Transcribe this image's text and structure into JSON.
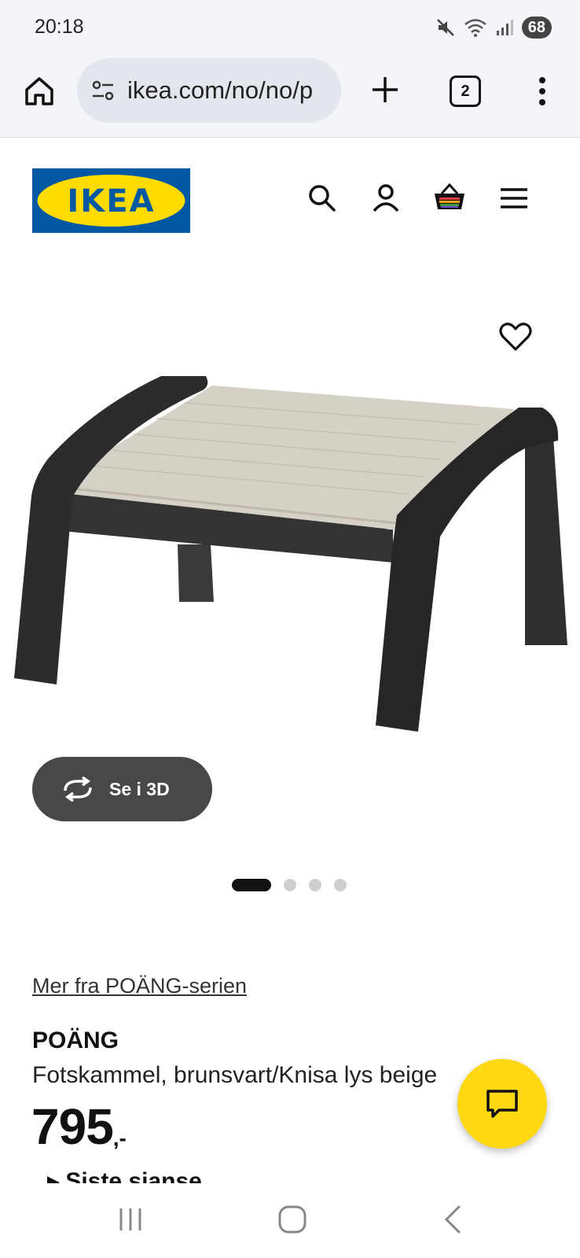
{
  "status": {
    "time": "20:18",
    "battery": "68"
  },
  "browser": {
    "url": "ikea.com/no/no/p",
    "tab_count": "2"
  },
  "header": {
    "logo_text": "IKEA",
    "brand_colors": {
      "blue": "#0058a3",
      "yellow": "#ffdb00"
    },
    "icons": [
      "search-icon",
      "account-icon",
      "basket-icon",
      "menu-icon"
    ]
  },
  "gallery": {
    "view3d_label": "Se i 3D",
    "slides": 4,
    "active_slide": 1
  },
  "product": {
    "series_link": "Mer fra POÄNG-serien",
    "name": "POÄNG",
    "description": "Fotskammel, brunsvart/Knisa lys beige",
    "price": "795",
    "price_suffix": ",-",
    "last_chance": "Siste sjanse"
  },
  "accent": "#ffd814"
}
